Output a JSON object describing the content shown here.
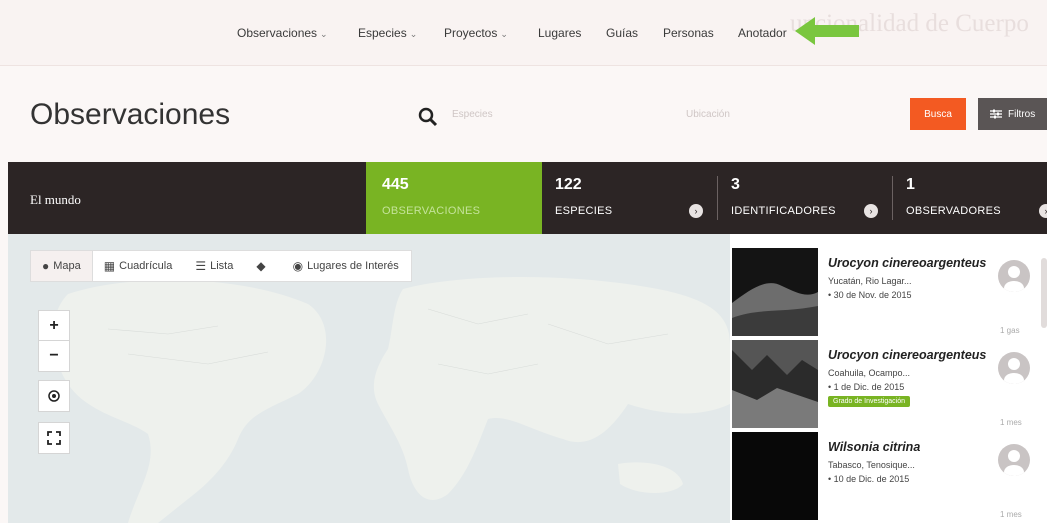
{
  "nav": {
    "items": [
      {
        "label": "Observaciones",
        "dropdown": true
      },
      {
        "label": "Especies",
        "dropdown": true
      },
      {
        "label": "Proyectos",
        "dropdown": true
      },
      {
        "label": "Lugares",
        "dropdown": false
      },
      {
        "label": "Guías",
        "dropdown": false
      },
      {
        "label": "Personas",
        "dropdown": false
      },
      {
        "label": "Anotador",
        "dropdown": false
      }
    ],
    "highlight_arrow_color": "#7ac63f"
  },
  "header": {
    "title": "Observaciones",
    "species_placeholder": "Especies",
    "location_placeholder": "Ubicación",
    "search_button": "Busca",
    "filters_button": "Filtros"
  },
  "stats": {
    "place": "El mundo",
    "observations": {
      "count": "445",
      "label": "OBSERVACIONES"
    },
    "species": {
      "count": "122",
      "label": "ESPECIES"
    },
    "identifiers": {
      "count": "3",
      "label": "IDENTIFICADORES"
    },
    "observers": {
      "count": "1",
      "label": "OBSERVADORES"
    }
  },
  "map": {
    "views": [
      "Mapa",
      "Cuadrícula",
      "Lista"
    ],
    "places_label": "Lugares de Interés",
    "controls": [
      "zoom-in",
      "zoom-out",
      "locate",
      "fullscreen"
    ]
  },
  "observations": [
    {
      "name": "Urocyon cinereoargenteus",
      "place": "Yucatán, Rio Lagar...",
      "date": "30 de Nov. de 2015",
      "badge": "",
      "time": "1 gas"
    },
    {
      "name": "Urocyon cinereoargenteus",
      "place": "Coahuila, Ocampo...",
      "date": "1 de Dic. de 2015",
      "badge": "Grado de Investigación",
      "time": "1 mes"
    },
    {
      "name": "Wilsonia citrina",
      "place": "Tabasco, Tenosique...",
      "date": "10 de Dic. de 2015",
      "badge": "",
      "time": "1 mes"
    }
  ],
  "colors": {
    "accent_green": "#79b423",
    "search_orange": "#f35a22",
    "dark_bar": "#2c2525"
  }
}
